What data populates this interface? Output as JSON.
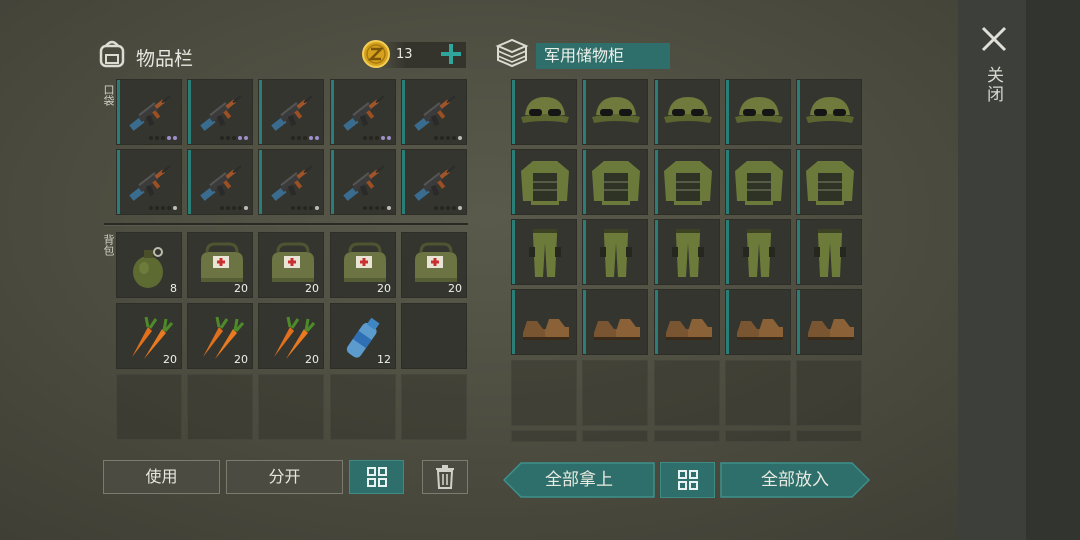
{
  "inventory": {
    "title": "物品栏",
    "coins": "13",
    "pocket_label": "口袋",
    "backpack_label": "背包",
    "pocket_slots": [
      {
        "item": "ak-rifle",
        "rarity": "purple"
      },
      {
        "item": "ak-rifle",
        "rarity": "purple"
      },
      {
        "item": "ak-rifle",
        "rarity": "purple"
      },
      {
        "item": "ak-rifle",
        "rarity": "purple"
      },
      {
        "item": "ak-rifle",
        "rarity": "gray"
      },
      {
        "item": "ak-rifle",
        "rarity": "gray"
      },
      {
        "item": "ak-rifle",
        "rarity": "gray"
      },
      {
        "item": "ak-rifle",
        "rarity": "gray"
      },
      {
        "item": "ak-rifle",
        "rarity": "gray"
      },
      {
        "item": "ak-rifle",
        "rarity": "gray"
      }
    ],
    "backpack_slots": [
      {
        "item": "grenade",
        "count": "8"
      },
      {
        "item": "medkit",
        "count": "20"
      },
      {
        "item": "medkit",
        "count": "20"
      },
      {
        "item": "medkit",
        "count": "20"
      },
      {
        "item": "medkit",
        "count": "20"
      },
      {
        "item": "carrot",
        "count": "20"
      },
      {
        "item": "carrot",
        "count": "20"
      },
      {
        "item": "carrot",
        "count": "20"
      },
      {
        "item": "water-bottle",
        "count": "12"
      },
      {
        "item": "",
        "count": ""
      },
      {
        "item": "",
        "count": ""
      },
      {
        "item": "",
        "count": ""
      },
      {
        "item": "",
        "count": ""
      },
      {
        "item": "",
        "count": ""
      },
      {
        "item": "",
        "count": ""
      }
    ],
    "buttons": {
      "use": "使用",
      "split": "分开"
    }
  },
  "cabinet": {
    "title": "军用储物柜",
    "rows": [
      [
        "military-cap",
        "military-cap",
        "military-cap",
        "military-cap",
        "military-cap"
      ],
      [
        "military-jacket",
        "military-jacket",
        "military-jacket",
        "military-jacket",
        "military-jacket"
      ],
      [
        "military-pants",
        "military-pants",
        "military-pants",
        "military-pants",
        "military-pants"
      ],
      [
        "military-boots",
        "military-boots",
        "military-boots",
        "military-boots",
        "military-boots"
      ]
    ],
    "buttons": {
      "take_all": "全部拿上",
      "put_all": "全部放入"
    }
  },
  "side": {
    "close_label": "关闭"
  },
  "colors": {
    "accent": "#2e6f6b",
    "strip": "#2b7e78",
    "rarity_purple": "#9f8fc8"
  }
}
